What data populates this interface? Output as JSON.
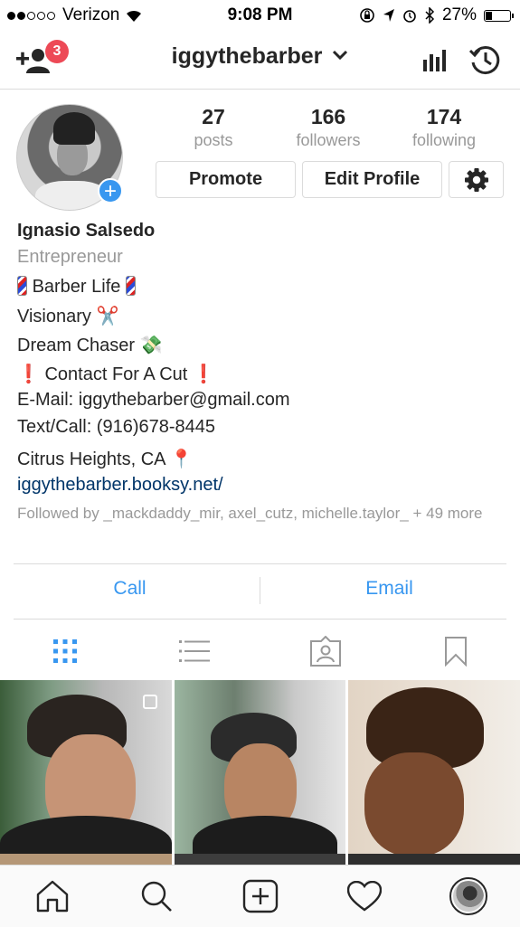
{
  "status_bar": {
    "carrier": "Verizon",
    "time": "9:08 PM",
    "battery": "27%",
    "battery_level": 0.27
  },
  "header": {
    "username": "iggythebarber",
    "notification_count": "3"
  },
  "profile": {
    "stats": [
      {
        "number": "27",
        "label": "posts"
      },
      {
        "number": "166",
        "label": "followers"
      },
      {
        "number": "174",
        "label": "following"
      }
    ],
    "promote_label": "Promote",
    "edit_label": "Edit Profile"
  },
  "bio": {
    "name": "Ignasio Salsedo",
    "category": "Entrepreneur",
    "line1": "Barber Life",
    "line2": "Visionary ✂️",
    "line3": "Dream Chaser 💸",
    "line4": "Contact For A Cut",
    "email": "E-Mail: iggythebarber@gmail.com",
    "phone": "Text/Call: (916)678-8445",
    "location": "Citrus Heights, CA 📍",
    "website": "iggythebarber.booksy.net/",
    "followed_by": "Followed by _mackdaddy_mir, axel_cutz, michelle.taylor_ + 49 more"
  },
  "actions": {
    "call": "Call",
    "email": "Email"
  },
  "colors": {
    "accent": "#3897f0",
    "badge": "#ed4956",
    "link": "#003569",
    "muted": "#999999"
  },
  "tabs": [
    "grid-icon",
    "list-icon",
    "tagged-icon",
    "saved-icon"
  ],
  "bottom_nav": [
    "home-icon",
    "search-icon",
    "add-post-icon",
    "activity-heart-icon",
    "profile-avatar"
  ]
}
